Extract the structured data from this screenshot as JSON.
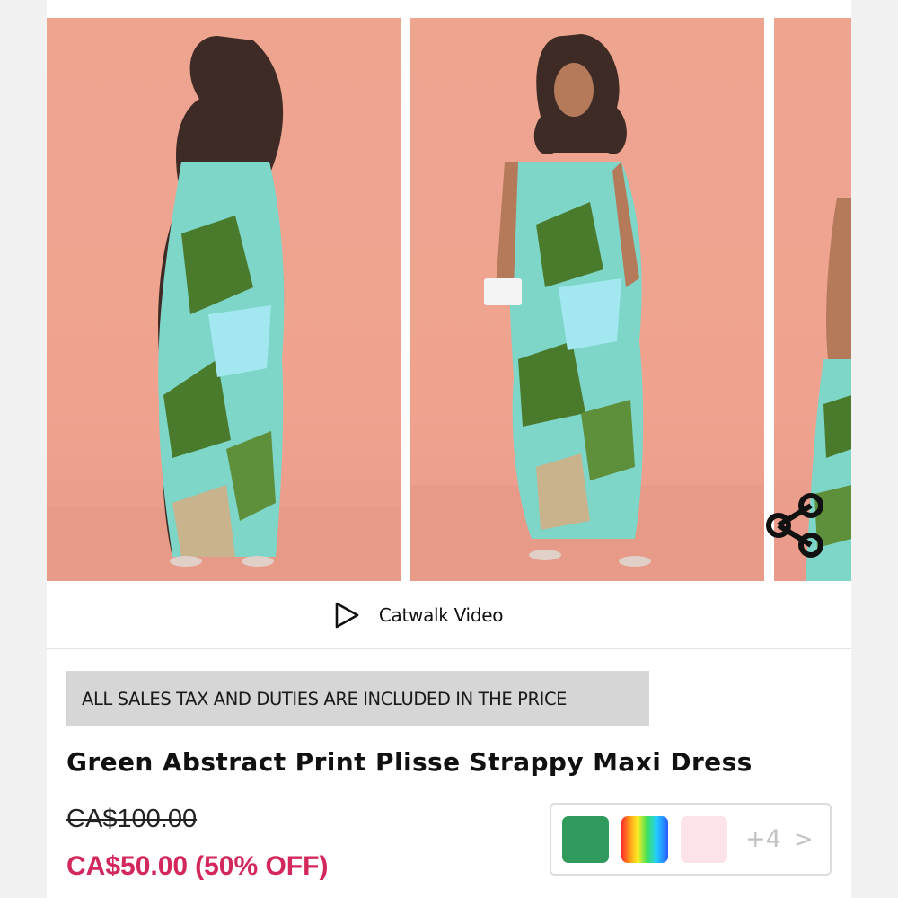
{
  "gallery": {
    "images": [
      {
        "name": "Back view of model in dress"
      },
      {
        "name": "Front view of model in dress"
      },
      {
        "name": "Partial view of dress"
      }
    ],
    "share_icon": "share-icon"
  },
  "video": {
    "icon": "play-icon",
    "label": "Catwalk Video"
  },
  "tax_banner": "ALL SALES TAX AND DUTIES ARE INCLUDED IN THE PRICE",
  "product": {
    "title": "Green Abstract Print Plisse Strappy Maxi Dress",
    "original_price": "CA$100.00",
    "sale_price": "CA$50.00",
    "discount": "(50% OFF)"
  },
  "colors": {
    "swatches": [
      "#2f9a5c",
      "rainbow",
      "#fde3e8"
    ],
    "more_label": "+4",
    "next_label": ">"
  },
  "theme": {
    "sale_color": "#d3285b",
    "background_color": "#eea590"
  }
}
